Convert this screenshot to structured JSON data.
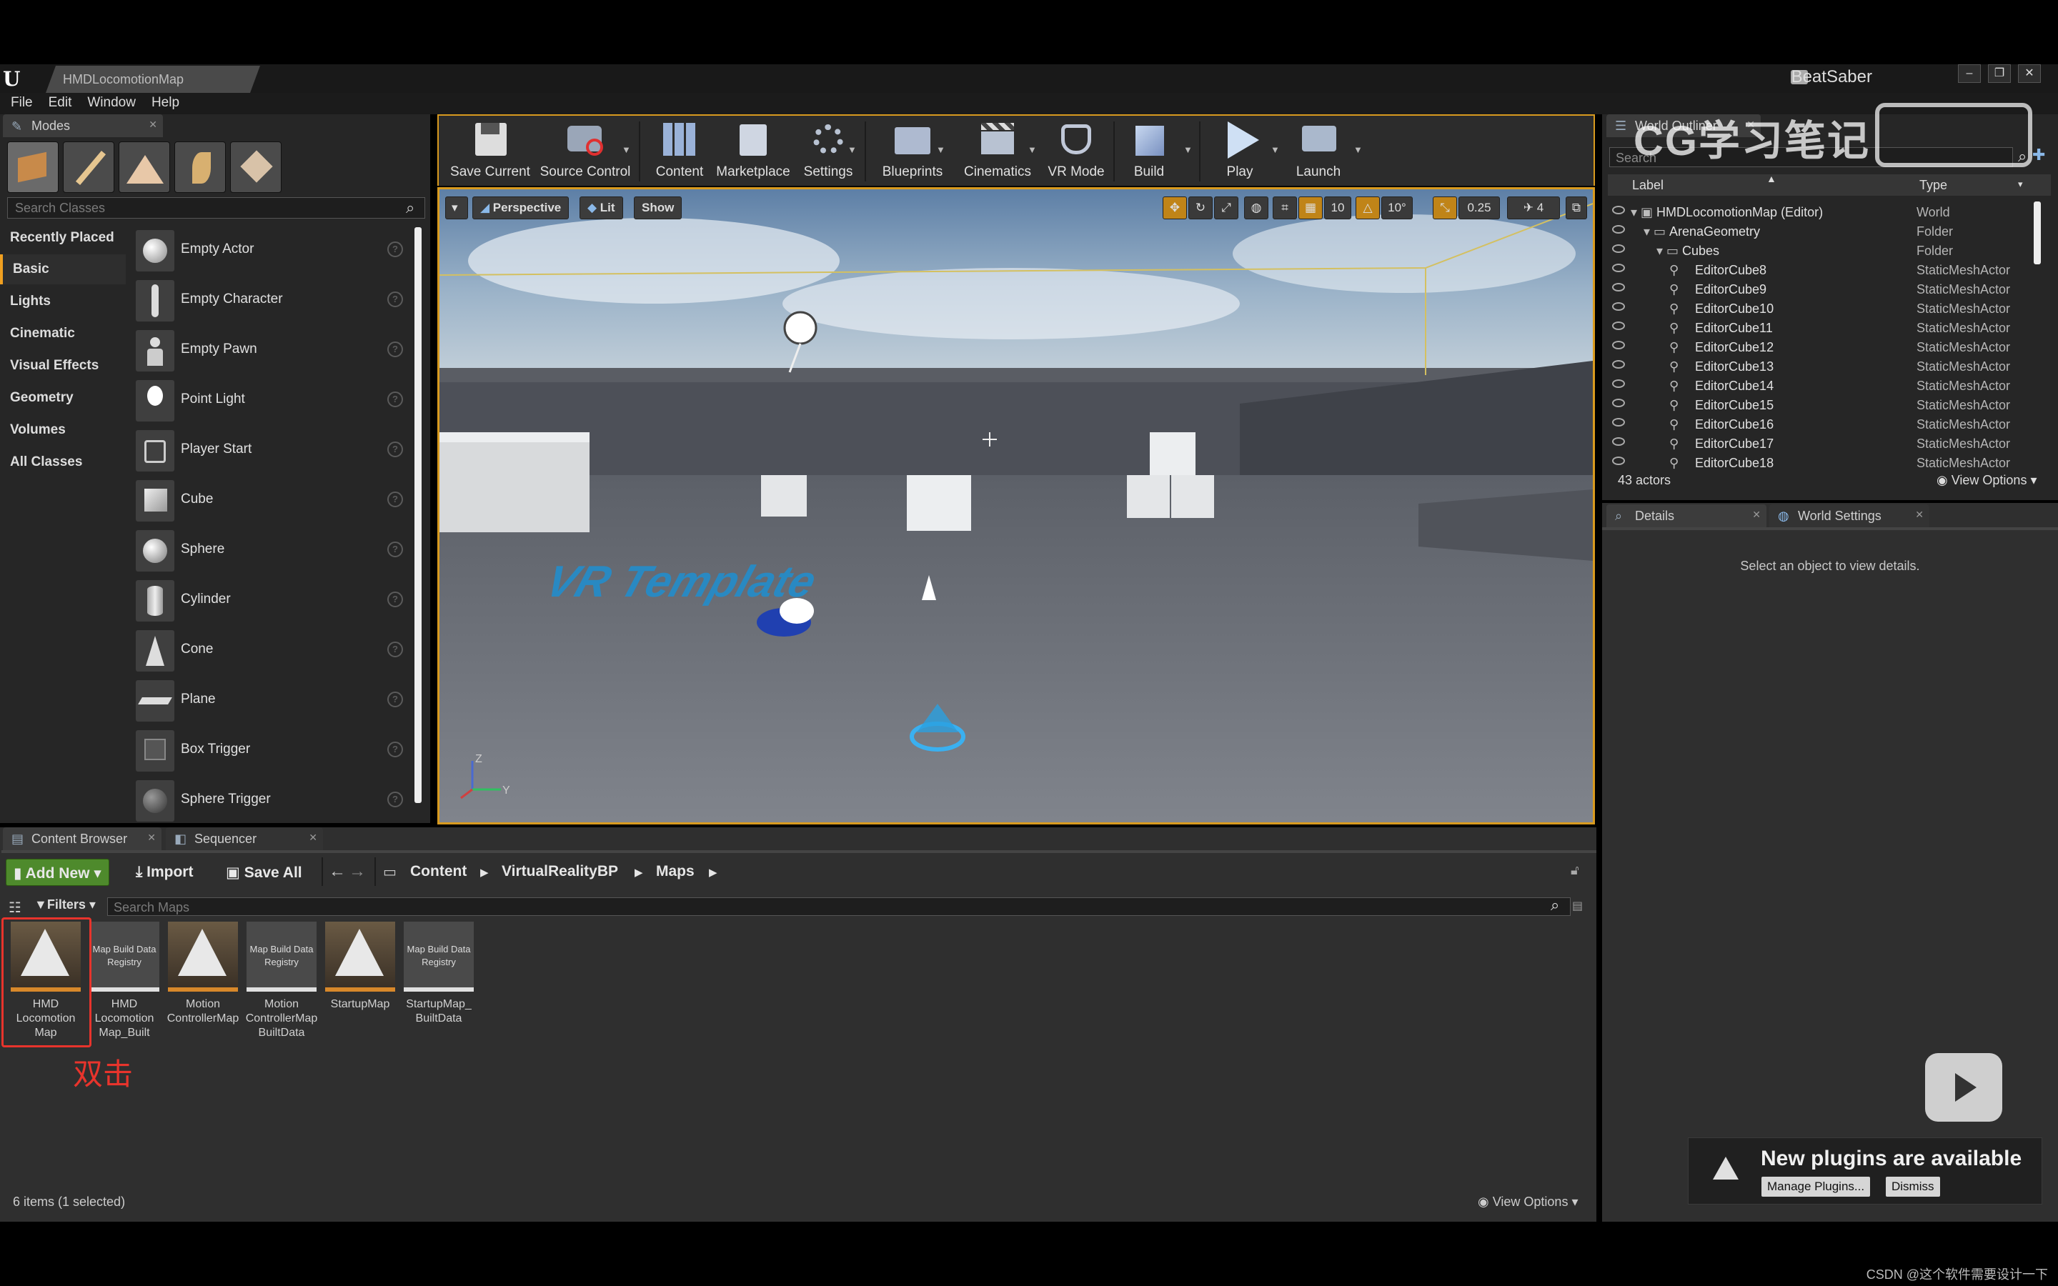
{
  "window": {
    "doc_tab": "HMDLocomotionMap",
    "project": "BeatSaber",
    "controls": [
      "–",
      "❐",
      "✕"
    ]
  },
  "menu": [
    "File",
    "Edit",
    "Window",
    "Help"
  ],
  "modes": {
    "tab": "Modes",
    "search_placeholder": "Search Classes",
    "categories": [
      "Recently Placed",
      "Basic",
      "Lights",
      "Cinematic",
      "Visual Effects",
      "Geometry",
      "Volumes",
      "All Classes"
    ],
    "items": [
      "Empty Actor",
      "Empty Character",
      "Empty Pawn",
      "Point Light",
      "Player Start",
      "Cube",
      "Sphere",
      "Cylinder",
      "Cone",
      "Plane",
      "Box Trigger",
      "Sphere Trigger"
    ]
  },
  "toolbar": {
    "tools": [
      "Save Current",
      "Source Control",
      "Content",
      "Marketplace",
      "Settings",
      "Blueprints",
      "Cinematics",
      "VR Mode",
      "Build",
      "Play",
      "Launch"
    ]
  },
  "viewport": {
    "perspective": "Perspective",
    "lit": "Lit",
    "show": "Show",
    "grid_snap": "10",
    "rot_snap": "10°",
    "scale_snap": "0.25",
    "cam_speed": "4",
    "floor_text": "VR Template",
    "axis_z": "Z",
    "axis_y": "Y"
  },
  "outliner": {
    "tab": "World Outliner",
    "search_placeholder": "Search",
    "col_label": "Label",
    "col_type": "Type",
    "rows": [
      {
        "label": "HMDLocomotionMap (Editor)",
        "type": "World",
        "indent": 0
      },
      {
        "label": "ArenaGeometry",
        "type": "Folder",
        "indent": 1
      },
      {
        "label": "Cubes",
        "type": "Folder",
        "indent": 2
      },
      {
        "label": "EditorCube8",
        "type": "StaticMeshActor",
        "indent": 3
      },
      {
        "label": "EditorCube9",
        "type": "StaticMeshActor",
        "indent": 3
      },
      {
        "label": "EditorCube10",
        "type": "StaticMeshActor",
        "indent": 3
      },
      {
        "label": "EditorCube11",
        "type": "StaticMeshActor",
        "indent": 3
      },
      {
        "label": "EditorCube12",
        "type": "StaticMeshActor",
        "indent": 3
      },
      {
        "label": "EditorCube13",
        "type": "StaticMeshActor",
        "indent": 3
      },
      {
        "label": "EditorCube14",
        "type": "StaticMeshActor",
        "indent": 3
      },
      {
        "label": "EditorCube15",
        "type": "StaticMeshActor",
        "indent": 3
      },
      {
        "label": "EditorCube16",
        "type": "StaticMeshActor",
        "indent": 3
      },
      {
        "label": "EditorCube17",
        "type": "StaticMeshActor",
        "indent": 3
      },
      {
        "label": "EditorCube18",
        "type": "StaticMeshActor",
        "indent": 3
      }
    ],
    "count": "43 actors",
    "view_options": "View Options"
  },
  "details": {
    "tab_details": "Details",
    "tab_world": "World Settings",
    "empty_msg": "Select an object to view details."
  },
  "content_browser": {
    "tab": "Content Browser",
    "tab2": "Sequencer",
    "add_new": "Add New",
    "import": "Import",
    "save_all": "Save All",
    "path": [
      "Content",
      "VirtualRealityBP",
      "Maps"
    ],
    "filters": "Filters",
    "search_placeholder": "Search Maps",
    "assets": [
      {
        "name": "HMD Locomotion Map",
        "kind": "map",
        "selected": true
      },
      {
        "name": "HMD Locomotion Map_Built",
        "kind": "registry",
        "selected": false
      },
      {
        "name": "Motion ControllerMap",
        "kind": "map",
        "selected": false
      },
      {
        "name": "Motion ControllerMap BuiltData",
        "kind": "registry",
        "selected": false
      },
      {
        "name": "StartupMap",
        "kind": "map",
        "selected": false
      },
      {
        "name": "StartupMap_ BuiltData",
        "kind": "registry",
        "selected": false
      }
    ],
    "registry_text": "Map Build Data Registry",
    "status": "6 items (1 selected)",
    "view_options": "View Options",
    "annotation": "双击"
  },
  "notification": {
    "title": "New plugins are available",
    "manage": "Manage Plugins...",
    "dismiss": "Dismiss"
  },
  "watermark": {
    "top": "CG学习笔记",
    "credit": "CSDN @这个软件需要设计一下"
  },
  "colors": {
    "accent": "#d89a1f",
    "add_new_green": "#4e8a2c",
    "annotation_red": "#e8342c"
  }
}
